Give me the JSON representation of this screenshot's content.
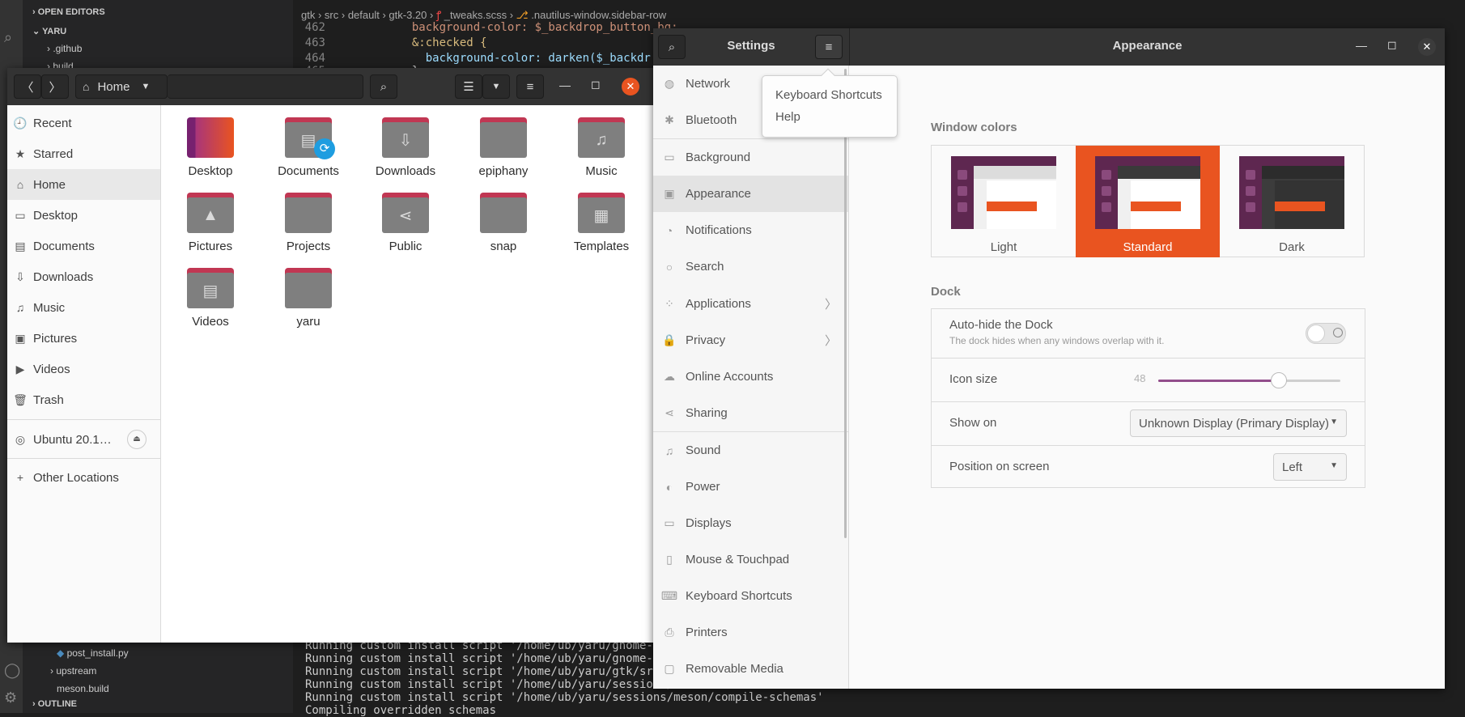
{
  "vscode": {
    "explorer": {
      "open_editors": "OPEN EDITORS",
      "project": "YARU",
      "items_top": [
        ".github",
        "build"
      ],
      "items_bottom": [
        "post_install.py",
        "upstream",
        "meson.build"
      ],
      "outline": "OUTLINE"
    },
    "breadcrumb": [
      "gtk",
      "src",
      "default",
      "gtk-3.20",
      "_tweaks.scss",
      ".nautilus-window.sidebar-row"
    ],
    "code": [
      {
        "ln": "462",
        "text": "  background-color: $_backdrop_button_bg;"
      },
      {
        "ln": "463",
        "text": "  &:checked {"
      },
      {
        "ln": "464",
        "text": "    background-color: darken($_backdr"
      },
      {
        "ln": "465",
        "text": "  }"
      }
    ],
    "terminal": [
      "Running custom install script '/home/ub/yaru/gnome-she",
      "Running custom install script '/home/ub/yaru/gnome-she",
      "Running custom install script '/home/ub/yaru/gtk/src/p",
      "Running custom install script '/home/ub/yaru/sessions/",
      "Running custom install script '/home/ub/yaru/sessions/meson/compile-schemas'",
      "Compiling overridden schemas"
    ]
  },
  "nautilus": {
    "location": "Home",
    "sidebar": [
      "Recent",
      "Starred",
      "Home",
      "Desktop",
      "Documents",
      "Downloads",
      "Music",
      "Pictures",
      "Videos",
      "Trash"
    ],
    "sidebar_icons": [
      "🕘",
      "★",
      "⌂",
      "▭",
      "▤",
      "⇩",
      "♫",
      "▣",
      "▶",
      "🗑"
    ],
    "device": "Ubuntu 20.1…",
    "other_locations": "Other Locations",
    "files": [
      "Desktop",
      "Documents",
      "Downloads",
      "epiphany",
      "Music",
      "Pictures",
      "Projects",
      "Public",
      "snap",
      "Templates",
      "Videos",
      "yaru"
    ],
    "file_icons": [
      "",
      "▤",
      "⇩",
      "",
      "♫",
      "▲",
      "",
      "⋖",
      "",
      "▦",
      "▤",
      ""
    ]
  },
  "settings": {
    "title": "Settings",
    "panel_title": "Appearance",
    "menu": {
      "keyboard_shortcuts": "Keyboard Shortcuts",
      "help": "Help"
    },
    "nav": [
      {
        "label": "Network",
        "icon": "◍"
      },
      {
        "label": "Bluetooth",
        "icon": "✱"
      },
      {
        "label": "Background",
        "icon": "▭"
      },
      {
        "label": "Appearance",
        "icon": "▣"
      },
      {
        "label": "Notifications",
        "icon": "◔"
      },
      {
        "label": "Search",
        "icon": "○"
      },
      {
        "label": "Applications",
        "icon": "⁘",
        "arrow": "〉"
      },
      {
        "label": "Privacy",
        "icon": "🔒",
        "arrow": "〉"
      },
      {
        "label": "Online Accounts",
        "icon": "☁"
      },
      {
        "label": "Sharing",
        "icon": "⋖"
      },
      {
        "label": "Sound",
        "icon": "♫"
      },
      {
        "label": "Power",
        "icon": "◐"
      },
      {
        "label": "Displays",
        "icon": "▭"
      },
      {
        "label": "Mouse & Touchpad",
        "icon": "▯"
      },
      {
        "label": "Keyboard Shortcuts",
        "icon": "⌨"
      },
      {
        "label": "Printers",
        "icon": "⎙"
      },
      {
        "label": "Removable Media",
        "icon": "▢"
      }
    ],
    "selected_nav": "Appearance",
    "window_colors": {
      "title": "Window colors",
      "options": [
        "Light",
        "Standard",
        "Dark"
      ],
      "selected": "Standard"
    },
    "dock": {
      "title": "Dock",
      "autohide_label": "Auto-hide the Dock",
      "autohide_desc": "The dock hides when any windows overlap with it.",
      "autohide_on": false,
      "icon_size_label": "Icon size",
      "icon_size_value": "48",
      "icon_size_fraction": 0.66,
      "show_on_label": "Show on",
      "show_on_value": "Unknown Display (Primary Display)",
      "position_label": "Position on screen",
      "position_value": "Left"
    }
  },
  "colors": {
    "accent": "#e95420",
    "aubergine": "#77216f",
    "slider": "#924d8b",
    "close": "#e95420"
  }
}
